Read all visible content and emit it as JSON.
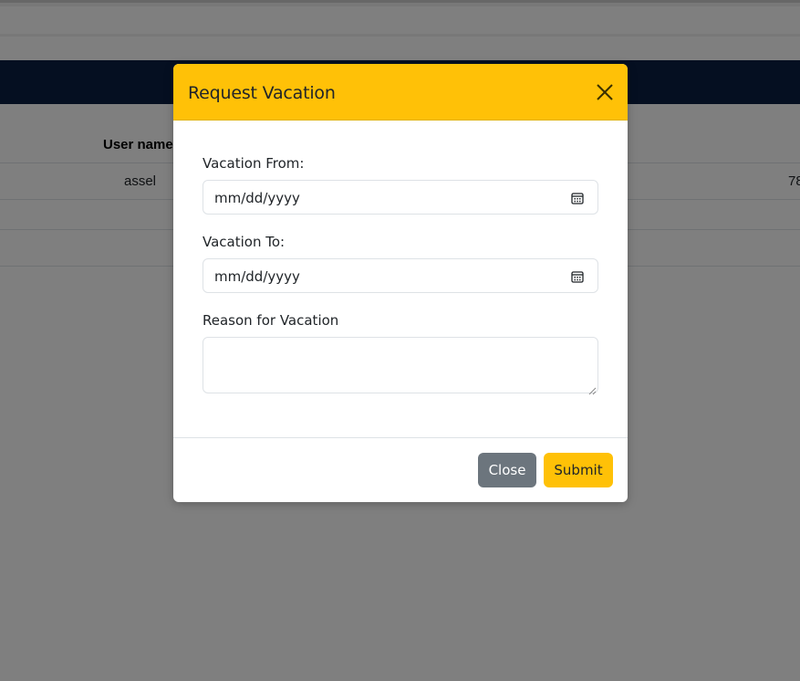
{
  "background_page": {
    "table": {
      "headers": [
        "User name"
      ],
      "rows": [
        {
          "user": "assel",
          "number": "78"
        }
      ]
    }
  },
  "modal": {
    "title": "Request Vacation",
    "fields": {
      "vacation_from": {
        "label": "Vacation From:",
        "placeholder": "mm/dd/yyyy"
      },
      "vacation_to": {
        "label": "Vacation To:",
        "placeholder": "mm/dd/yyyy"
      },
      "reason": {
        "label": "Reason for Vacation",
        "value": ""
      }
    },
    "footer": {
      "close_label": "Close",
      "submit_label": "Submit"
    }
  },
  "icons": {
    "close": "close-icon",
    "calendar": "calendar-icon",
    "resize": "resize-grip-icon"
  },
  "colors": {
    "accent": "#ffc107",
    "secondary_button": "#6c757d",
    "navbar": "#0a1e43",
    "backdrop": "rgba(0,0,0,0.5)"
  }
}
